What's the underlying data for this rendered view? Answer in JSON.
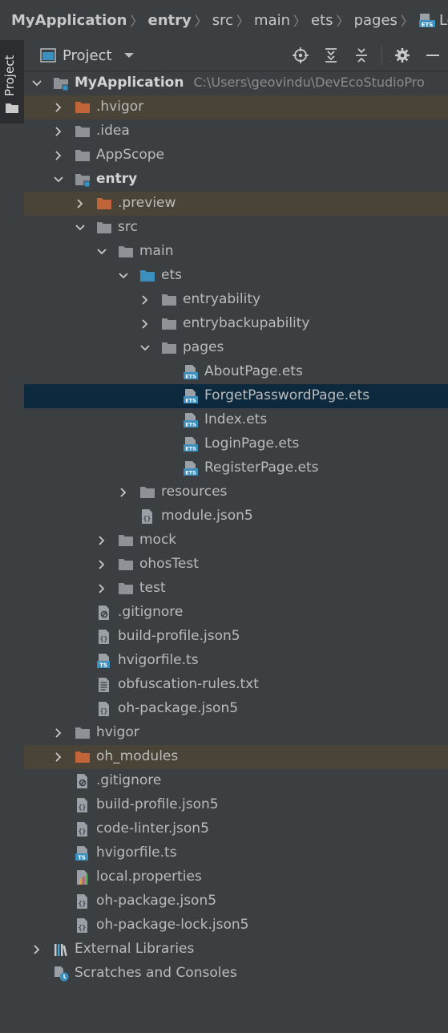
{
  "breadcrumb": [
    {
      "label": "MyApplication",
      "bold": true
    },
    {
      "label": "entry",
      "bold": true
    },
    {
      "label": "src"
    },
    {
      "label": "main"
    },
    {
      "label": "ets"
    },
    {
      "label": "pages"
    },
    {
      "label": "LoginPa",
      "icon": "ets-file-icon"
    }
  ],
  "side_stripe": {
    "tab_label": "Project"
  },
  "panel": {
    "title": "Project",
    "tools": [
      "locate-icon",
      "expand-all-icon",
      "collapse-all-icon",
      "gear-icon",
      "minimize-icon"
    ]
  },
  "tree": [
    {
      "label": "MyApplication",
      "path": "C:\\Users\\geovindu\\DevEcoStudioPro",
      "depth": 0,
      "arrow": "down",
      "icon": "module-folder",
      "bold": true
    },
    {
      "label": ".hvigor",
      "depth": 1,
      "arrow": "right",
      "icon": "folder-excluded",
      "excluded": true
    },
    {
      "label": ".idea",
      "depth": 1,
      "arrow": "right",
      "icon": "folder"
    },
    {
      "label": "AppScope",
      "depth": 1,
      "arrow": "right",
      "icon": "folder"
    },
    {
      "label": "entry",
      "depth": 1,
      "arrow": "down",
      "icon": "module-folder",
      "bold": true
    },
    {
      "label": ".preview",
      "depth": 2,
      "arrow": "right",
      "icon": "folder-excluded",
      "excluded": true
    },
    {
      "label": "src",
      "depth": 2,
      "arrow": "down",
      "icon": "folder"
    },
    {
      "label": "main",
      "depth": 3,
      "arrow": "down",
      "icon": "folder"
    },
    {
      "label": "ets",
      "depth": 4,
      "arrow": "down",
      "icon": "folder-source"
    },
    {
      "label": "entryability",
      "depth": 5,
      "arrow": "right",
      "icon": "folder"
    },
    {
      "label": "entrybackupability",
      "depth": 5,
      "arrow": "right",
      "icon": "folder"
    },
    {
      "label": "pages",
      "depth": 5,
      "arrow": "down",
      "icon": "folder"
    },
    {
      "label": "AboutPage.ets",
      "depth": 6,
      "icon": "ets-file"
    },
    {
      "label": "ForgetPasswordPage.ets",
      "depth": 6,
      "icon": "ets-file",
      "selected": true
    },
    {
      "label": "Index.ets",
      "depth": 6,
      "icon": "ets-file"
    },
    {
      "label": "LoginPage.ets",
      "depth": 6,
      "icon": "ets-file"
    },
    {
      "label": "RegisterPage.ets",
      "depth": 6,
      "icon": "ets-file"
    },
    {
      "label": "resources",
      "depth": 4,
      "arrow": "right",
      "icon": "folder"
    },
    {
      "label": "module.json5",
      "depth": 4,
      "icon": "json-file"
    },
    {
      "label": "mock",
      "depth": 3,
      "arrow": "right",
      "icon": "folder"
    },
    {
      "label": "ohosTest",
      "depth": 3,
      "arrow": "right",
      "icon": "folder"
    },
    {
      "label": "test",
      "depth": 3,
      "arrow": "right",
      "icon": "folder"
    },
    {
      "label": ".gitignore",
      "depth": 2,
      "icon": "gitignore-file"
    },
    {
      "label": "build-profile.json5",
      "depth": 2,
      "icon": "json-file"
    },
    {
      "label": "hvigorfile.ts",
      "depth": 2,
      "icon": "ts-file"
    },
    {
      "label": "obfuscation-rules.txt",
      "depth": 2,
      "icon": "text-file"
    },
    {
      "label": "oh-package.json5",
      "depth": 2,
      "icon": "json-file"
    },
    {
      "label": "hvigor",
      "depth": 1,
      "arrow": "right",
      "icon": "folder"
    },
    {
      "label": "oh_modules",
      "depth": 1,
      "arrow": "right",
      "icon": "folder-excluded",
      "excluded": true
    },
    {
      "label": ".gitignore",
      "depth": 1,
      "icon": "gitignore-file"
    },
    {
      "label": "build-profile.json5",
      "depth": 1,
      "icon": "json-file"
    },
    {
      "label": "code-linter.json5",
      "depth": 1,
      "icon": "json-file"
    },
    {
      "label": "hvigorfile.ts",
      "depth": 1,
      "icon": "ts-file"
    },
    {
      "label": "local.properties",
      "depth": 1,
      "icon": "properties-file"
    },
    {
      "label": "oh-package.json5",
      "depth": 1,
      "icon": "json-file"
    },
    {
      "label": "oh-package-lock.json5",
      "depth": 1,
      "icon": "json-file"
    },
    {
      "label": "External Libraries",
      "depth": 0,
      "arrow": "right",
      "icon": "libraries"
    },
    {
      "label": "Scratches and Consoles",
      "depth": 0,
      "icon": "scratches"
    }
  ],
  "colors": {
    "panel_bg": "#3c3f41",
    "selected_row": "#0d293e",
    "excluded_row": "#4a4438",
    "folder": "#8e9297",
    "folder_excluded": "#c2643a",
    "folder_source": "#3b8fbf"
  }
}
